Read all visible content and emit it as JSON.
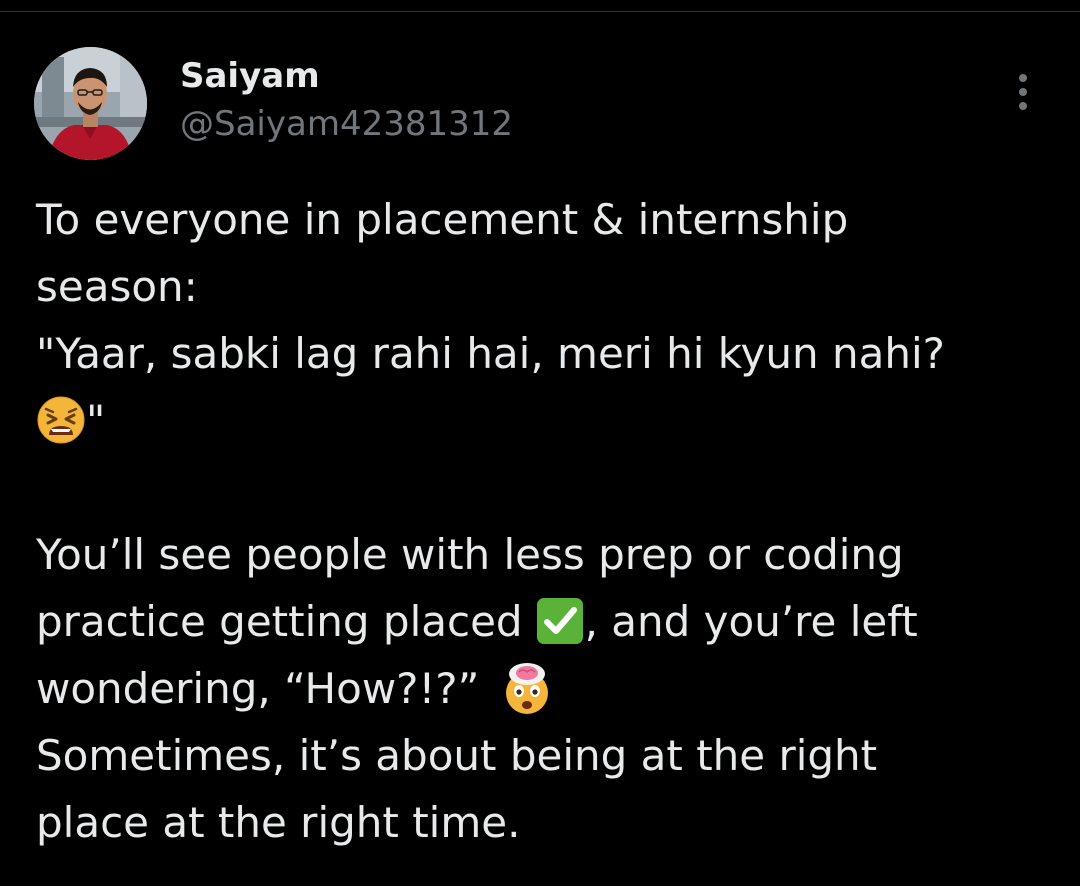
{
  "author": {
    "display_name": "Saiyam",
    "handle": "@Saiyam42381312",
    "avatar_icon": "profile-photo"
  },
  "tweet": {
    "lines": [
      "To everyone in  placement & internship",
      "season:",
      "\"Yaar, sabki lag rahi hai, meri hi kyun nahi?",
      "\"",
      "",
      "You’ll see people with less prep or coding",
      "practice getting placed",
      ", and you’re left",
      "wondering, “How?!?”",
      " Sometimes, it’s about being at the right",
      "place at the right time."
    ],
    "emojis": [
      "tired-face-emoji",
      "check-mark-button-emoji",
      "exploding-head-emoji"
    ]
  },
  "menu": {
    "icon": "more-options-icon"
  },
  "colors": {
    "background": "#000000",
    "primary_text": "#e7e9ea",
    "secondary_text": "#71767b",
    "divider": "#2f3336",
    "check_green": "#5bb239"
  }
}
